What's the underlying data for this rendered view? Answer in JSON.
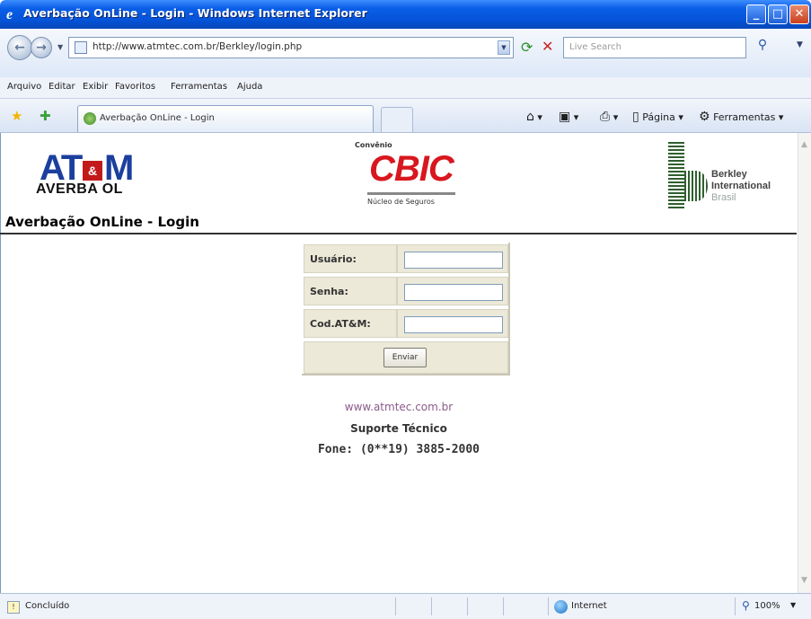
{
  "window": {
    "title": "Averbação OnLine - Login - Windows Internet Explorer"
  },
  "addressbar": {
    "url": "http://www.atmtec.com.br/Berkley/login.php",
    "search_placeholder": "Live Search"
  },
  "menu": [
    "Arquivo",
    "Editar",
    "Exibir",
    "Favoritos",
    "Ferramentas",
    "Ajuda"
  ],
  "tab": {
    "label": "Averbação OnLine - Login"
  },
  "toolbar": {
    "page_label": "Página",
    "tools_label": "Ferramentas"
  },
  "banner": {
    "atm_mark": "AT",
    "atm_amp": "&",
    "atm_m": "M",
    "atm_sub": "AVERBA OL",
    "cbic_convenio": "Convênio",
    "cbic_logo": "CBIC",
    "cbic_sub": "Núcleo de Seguros",
    "berkley_line1": "Berkley",
    "berkley_line2": "International",
    "berkley_line3": "Brasil"
  },
  "page": {
    "title": "Averbação OnLine - Login"
  },
  "form": {
    "user_label": "Usuário:",
    "password_label": "Senha:",
    "code_label": "Cod.AT&M:",
    "submit_label": "Enviar"
  },
  "footer": {
    "site": "www.atmtec.com.br",
    "support": "Suporte Técnico",
    "phone": "Fone: (0**19) 3885-2000"
  },
  "status": {
    "text": "Concluído",
    "zone": "Internet",
    "zoom": "100%"
  }
}
